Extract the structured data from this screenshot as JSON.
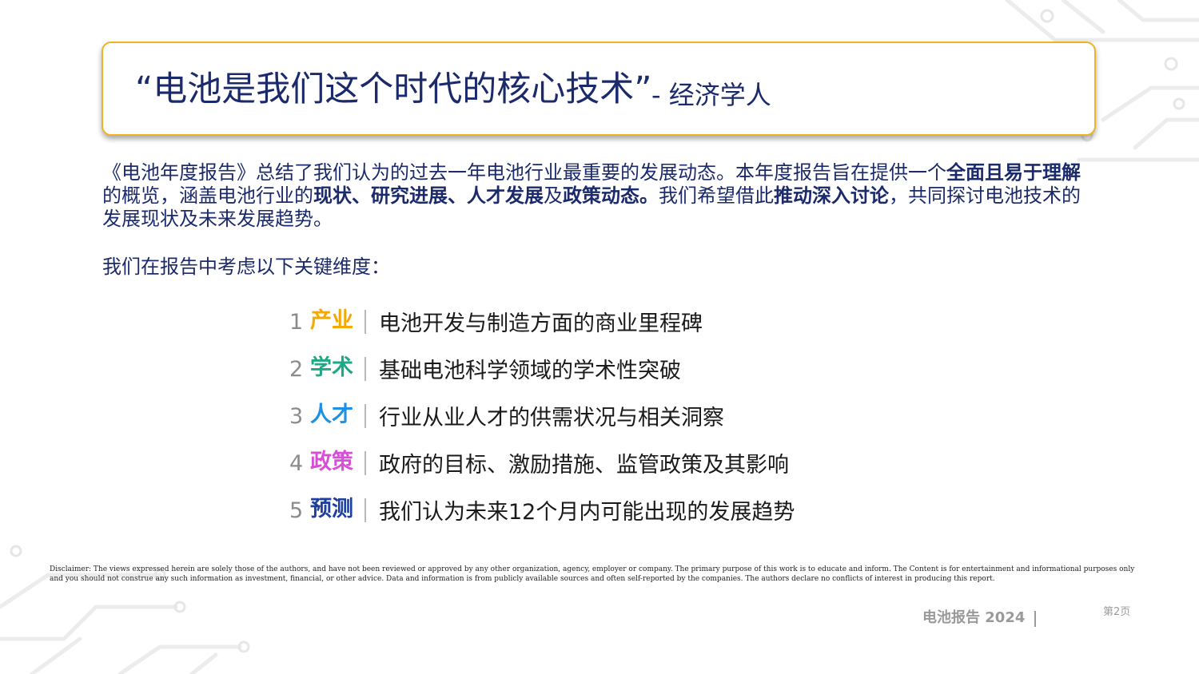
{
  "quote": {
    "text": "“电池是我们这个时代的核心技术”",
    "source": "- 经济学人"
  },
  "intro": {
    "segments": [
      {
        "text": "《电池年度报告》总结了我们认为的过去一年电池行业最重要的发展动态。本年度报告旨在提供一个",
        "bold": false
      },
      {
        "text": "全面且易于理解",
        "bold": true
      },
      {
        "text": "的概览，涵盖电池行业的",
        "bold": false
      },
      {
        "text": "现状、研究进展、人才发展",
        "bold": true
      },
      {
        "text": "及",
        "bold": false
      },
      {
        "text": "政策动态。",
        "bold": true
      },
      {
        "text": "我们希望借此",
        "bold": false
      },
      {
        "text": "推动深入讨论",
        "bold": true
      },
      {
        "text": "，共同探讨电池技术的发展现状及未来发展趋势。",
        "bold": false
      }
    ]
  },
  "dimensions_intro": "我们在报告中考虑以下关键维度：",
  "dimensions": [
    {
      "num": "1",
      "tag": "产业",
      "color": "#f5a800",
      "desc": "电池开发与制造方面的商业里程碑"
    },
    {
      "num": "2",
      "tag": "学术",
      "color": "#1ea885",
      "desc": "基础电池科学领域的学术性突破"
    },
    {
      "num": "3",
      "tag": "人才",
      "color": "#1e90e6",
      "desc": "行业从业人才的供需状况与相关洞察"
    },
    {
      "num": "4",
      "tag": "政策",
      "color": "#d64fd6",
      "desc": "政府的目标、激励措施、监管政策及其影响"
    },
    {
      "num": "5",
      "tag": "预测",
      "color": "#1f3f9f",
      "desc": "我们认为未来12个月内可能出现的发展趋势"
    }
  ],
  "disclaimer": "Disclaimer: The views expressed herein are solely those of the authors, and have not been reviewed or approved by any other organization, agency, employer or company. The primary purpose of this work is to educate and inform. The Content is for entertainment and informational purposes only and you should not construe any such information as investment, financial, or other advice. Data and information is from publicly available sources and often self-reported by the companies. The authors declare no conflicts of interest in producing this report.",
  "footer": {
    "title": "电池报告 2024",
    "page": "第2页"
  },
  "colors": {
    "navy": "#1b2a6b",
    "accent_border": "#f2b323"
  }
}
